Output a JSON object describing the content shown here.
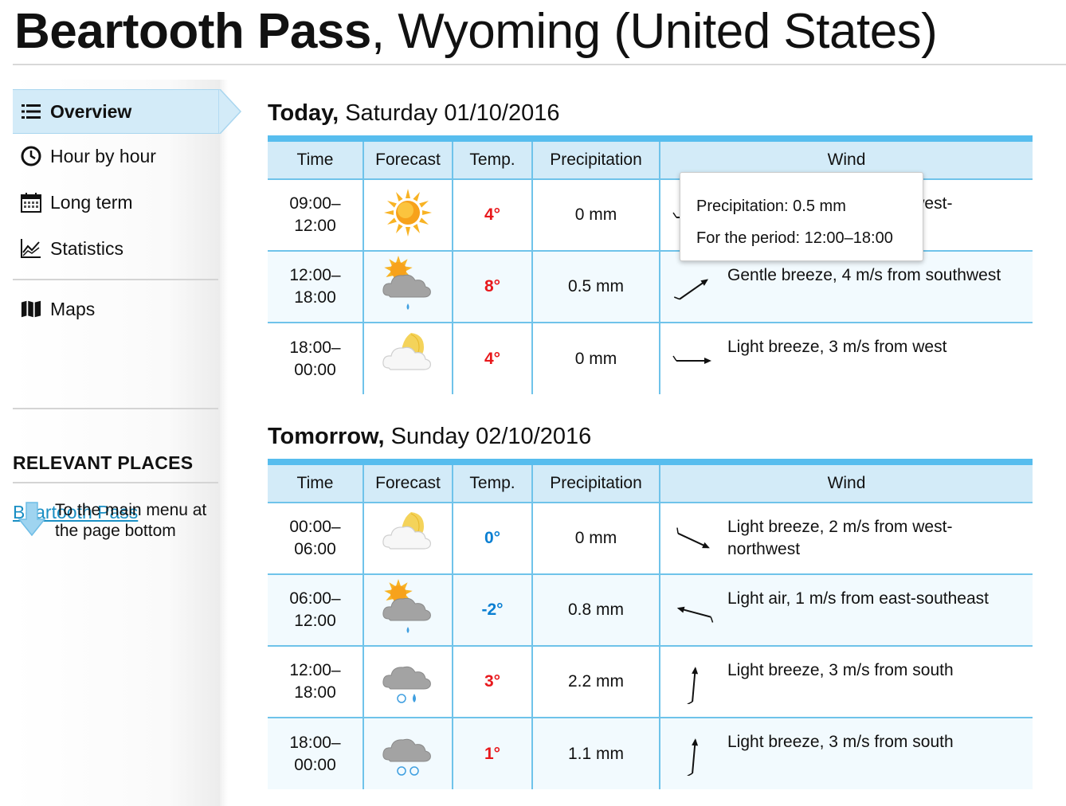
{
  "title": {
    "bold": "Beartooth Pass",
    "rest": ", Wyoming (United States)"
  },
  "sidebar": {
    "items": [
      {
        "label": "Overview",
        "icon": "list-icon"
      },
      {
        "label": "Hour by hour",
        "icon": "clock-icon"
      },
      {
        "label": "Long term",
        "icon": "calendar-icon"
      },
      {
        "label": "Statistics",
        "icon": "chart-icon"
      },
      {
        "label": "Maps",
        "icon": "map-icon"
      }
    ],
    "relevant_heading": "RELEVANT PLACES",
    "place_link": "Beartooth Pass",
    "main_menu_link": "To the main menu at the page bottom"
  },
  "headers": {
    "time": "Time",
    "forecast": "Forecast",
    "temp": "Temp.",
    "precip": "Precipitation",
    "wind": "Wind"
  },
  "colors": {
    "warm": "#e8181c",
    "cold": "#0a7fd2",
    "accent": "#57bdee"
  },
  "today": {
    "label": "Today,",
    "date": "Saturday 01/10/2016",
    "rows": [
      {
        "time_from": "09:00–",
        "time_to": "12:00",
        "icon": "sun-icon",
        "temp": "4°",
        "temp_class": "warm",
        "precip": "0 mm",
        "wind": "Light breeze, 2 m/s from west-",
        "wind_angle": 0
      },
      {
        "time_from": "12:00–",
        "time_to": "18:00",
        "icon": "sun-cloud-rain-icon",
        "temp": "8°",
        "temp_class": "warm",
        "precip": "0.5 mm",
        "wind": "Gentle breeze, 4 m/s from southwest",
        "wind_angle": -35
      },
      {
        "time_from": "18:00–",
        "time_to": "00:00",
        "icon": "moon-cloud-icon",
        "temp": "4°",
        "temp_class": "warm",
        "precip": "0 mm",
        "wind": "Light breeze, 3 m/s from west",
        "wind_angle": 0
      }
    ]
  },
  "tomorrow": {
    "label": "Tomorrow,",
    "date": "Sunday 02/10/2016",
    "rows": [
      {
        "time_from": "00:00–",
        "time_to": "06:00",
        "icon": "moon-cloud-icon",
        "temp": "0°",
        "temp_class": "cold",
        "precip": "0 mm",
        "wind": "Light breeze, 2 m/s from west-northwest",
        "wind_angle": 25
      },
      {
        "time_from": "06:00–",
        "time_to": "12:00",
        "icon": "sun-cloud-rain-icon",
        "temp": "-2°",
        "temp_class": "cold",
        "precip": "0.8 mm",
        "wind": "Light air, 1 m/s from east-southeast",
        "wind_angle": 195
      },
      {
        "time_from": "12:00–",
        "time_to": "18:00",
        "icon": "cloud-sleet-icon",
        "temp": "3°",
        "temp_class": "warm",
        "precip": "2.2 mm",
        "wind": "Light breeze, 3 m/s from south",
        "wind_angle": -85
      },
      {
        "time_from": "18:00–",
        "time_to": "00:00",
        "icon": "cloud-snow-icon",
        "temp": "1°",
        "temp_class": "warm",
        "precip": "1.1 mm",
        "wind": "Light breeze, 3 m/s from south",
        "wind_angle": -85
      }
    ]
  },
  "tooltip": {
    "line1": "Precipitation: 0.5 mm",
    "line2": "For the period: 12:00–18:00"
  }
}
